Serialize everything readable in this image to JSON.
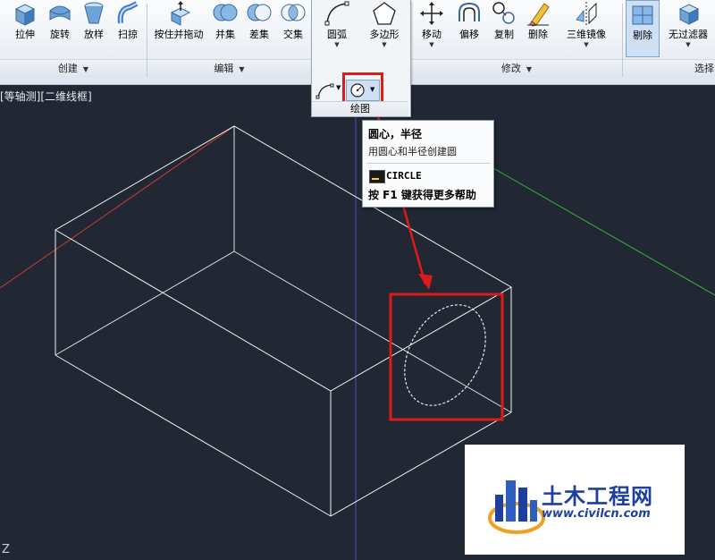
{
  "ribbon": {
    "panels": {
      "create": "创建",
      "edit": "编辑",
      "draw": "绘图",
      "modify": "修改",
      "select": "选择"
    },
    "create_buttons": [
      "拉伸",
      "旋转",
      "放样",
      "扫掠"
    ],
    "edit_buttons": [
      "按住并拖动",
      "并集",
      "差集",
      "交集"
    ],
    "draw_buttons": [
      "圆弧",
      "多边形"
    ],
    "modify_buttons": [
      "移动",
      "偏移",
      "复制",
      "删除",
      "三维镜像"
    ],
    "select_buttons": [
      "剔除",
      "无过滤器"
    ]
  },
  "viewport": {
    "label": "[等轴测][二维线框]",
    "axis_label": "Z"
  },
  "tooltip": {
    "title": "圆心，半径",
    "description": "用圆心和半径创建圆",
    "command": "CIRCLE",
    "help": "按 F1 键获得更多帮助"
  },
  "watermark": {
    "title": "土木工程网",
    "url": "www.civilcn.com"
  },
  "colors": {
    "viewport_bg": "#212834",
    "highlight": "#e01919",
    "axis_x": "#c83c3c",
    "axis_y": "#3fae3f",
    "axis_z": "#4b4bd6",
    "wireframe": "#f2f2f2"
  }
}
